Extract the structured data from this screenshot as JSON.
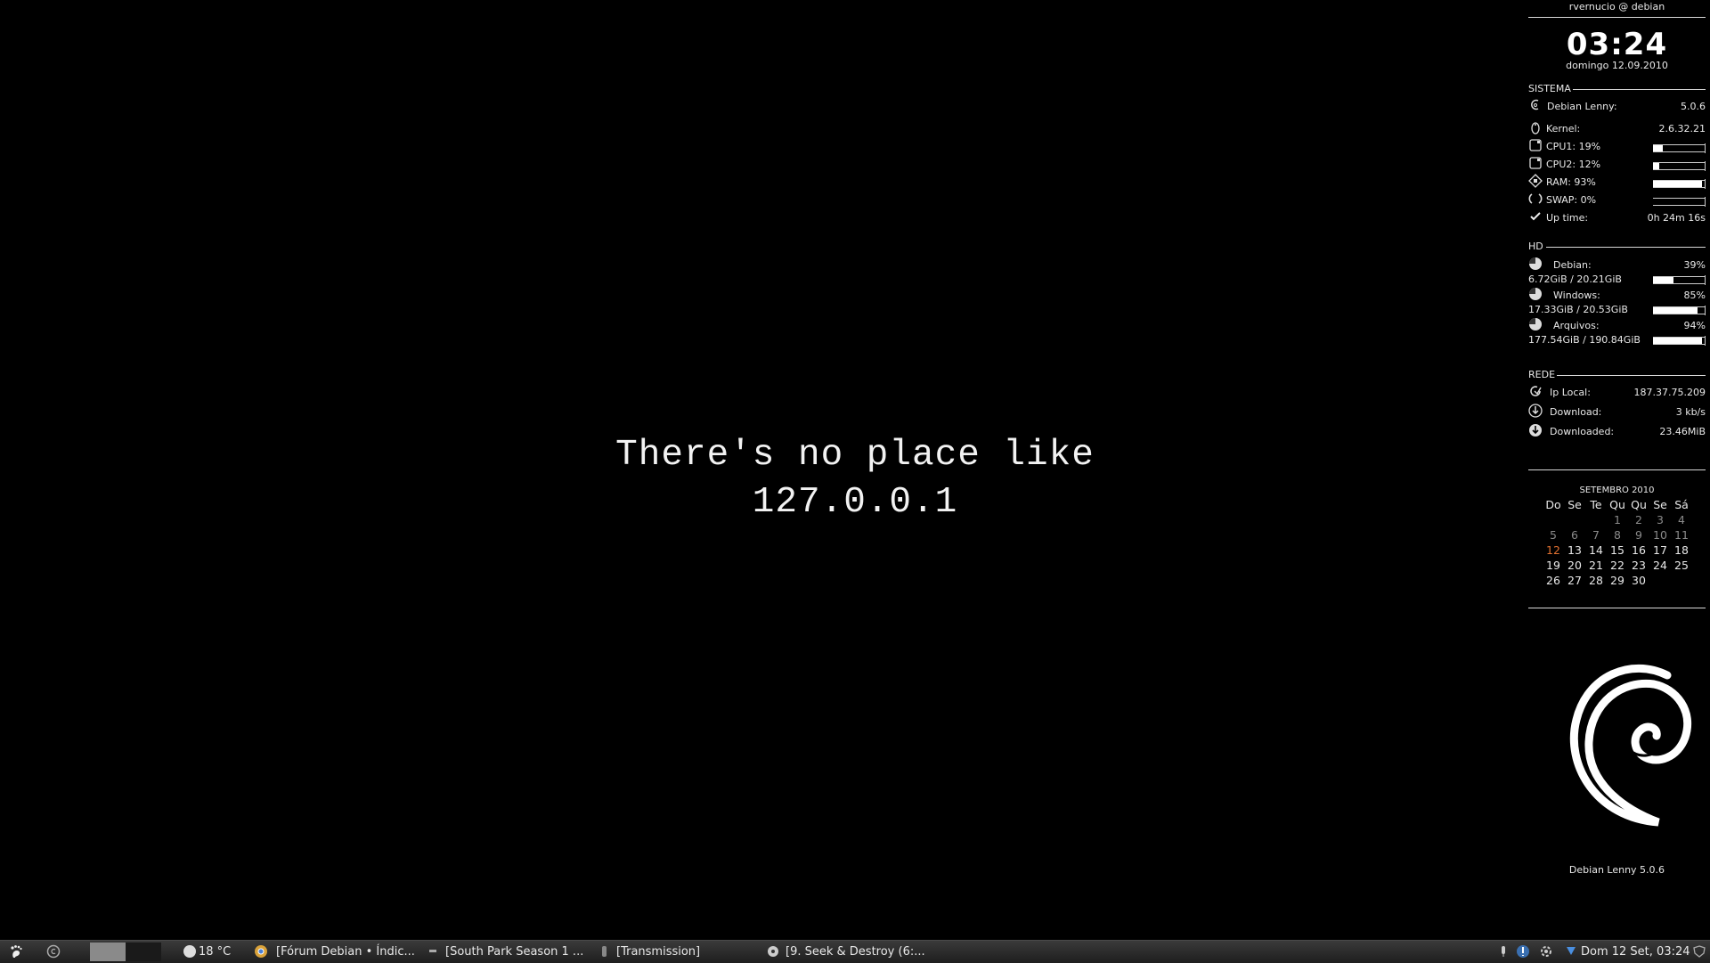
{
  "desktop": {
    "slogan_line1": "There's no place like",
    "slogan_line2": "127.0.0.1"
  },
  "conky": {
    "user_host": "rvernucio @ debian",
    "clock": "03:24",
    "date": "domingo 12.09.2010",
    "sistema": {
      "heading": "SISTEMA",
      "rows": [
        {
          "label": "Debian Lenny:",
          "value": "5.0.6",
          "icon": "debian-icon"
        },
        {
          "label": "Kernel:",
          "value": "2.6.32.21",
          "icon": "tux-icon"
        },
        {
          "label": "CPU1: 19%",
          "percent": 19,
          "icon": "cpu-icon"
        },
        {
          "label": "CPU2: 12%",
          "percent": 12,
          "icon": "cpu-icon"
        },
        {
          "label": "RAM: 93%",
          "percent": 93,
          "icon": "ram-icon"
        },
        {
          "label": "SWAP: 0%",
          "percent": 0,
          "icon": "swap-icon"
        },
        {
          "label": "Up time:",
          "value": "0h 24m 16s",
          "icon": "check-icon"
        }
      ]
    },
    "hd": {
      "heading": "HD",
      "disks": [
        {
          "label": "Debian:",
          "percent_label": "39%",
          "usage": "6.72GiB / 20.21GiB",
          "percent": 39
        },
        {
          "label": "Windows:",
          "percent_label": "85%",
          "usage": "17.33GiB / 20.53GiB",
          "percent": 85
        },
        {
          "label": "Arquivos:",
          "percent_label": "94%",
          "usage": "177.54GiB / 190.84GiB",
          "percent": 94
        }
      ]
    },
    "rede": {
      "heading": "REDE",
      "rows": [
        {
          "label": "Ip Local:",
          "value": "187.37.75.209",
          "icon": "refresh-icon"
        },
        {
          "label": "Download:",
          "value": "3 kb/s",
          "icon": "download-icon"
        },
        {
          "label": "Downloaded:",
          "value": "23.46MiB",
          "icon": "downloaded-icon"
        }
      ]
    },
    "calendar": {
      "title": "SETEMBRO 2010",
      "weekdays": [
        "Do",
        "Se",
        "Te",
        "Qu",
        "Qu",
        "Se",
        "Sá"
      ],
      "weeks": [
        [
          {
            "d": ""
          },
          {
            "d": ""
          },
          {
            "d": ""
          },
          {
            "d": "1",
            "dim": true
          },
          {
            "d": "2",
            "dim": true
          },
          {
            "d": "3",
            "dim": true
          },
          {
            "d": "4",
            "dim": true
          }
        ],
        [
          {
            "d": "5",
            "dim": true
          },
          {
            "d": "6",
            "dim": true
          },
          {
            "d": "7",
            "dim": true
          },
          {
            "d": "8",
            "dim": true
          },
          {
            "d": "9",
            "dim": true
          },
          {
            "d": "10",
            "dim": true
          },
          {
            "d": "11",
            "dim": true
          }
        ],
        [
          {
            "d": "12",
            "today": true
          },
          {
            "d": "13"
          },
          {
            "d": "14"
          },
          {
            "d": "15"
          },
          {
            "d": "16"
          },
          {
            "d": "17"
          },
          {
            "d": "18"
          }
        ],
        [
          {
            "d": "19"
          },
          {
            "d": "20"
          },
          {
            "d": "21"
          },
          {
            "d": "22"
          },
          {
            "d": "23"
          },
          {
            "d": "24"
          },
          {
            "d": "25"
          }
        ],
        [
          {
            "d": "26"
          },
          {
            "d": "27"
          },
          {
            "d": "28"
          },
          {
            "d": "29"
          },
          {
            "d": "30"
          },
          {
            "d": ""
          },
          {
            "d": ""
          }
        ]
      ]
    },
    "logo_caption": "Debian Lenny 5.0.6"
  },
  "taskbar": {
    "weather": "18 °C",
    "windows": [
      {
        "title": "[Fórum Debian • Índic...",
        "icon": "chrome-icon"
      },
      {
        "title": "[South Park Season 1 ...",
        "icon": "folder-icon"
      },
      {
        "title": "[Transmission]",
        "icon": "transmission-icon"
      },
      {
        "title": "[9. Seek & Destroy (6:...",
        "icon": "music-player-icon"
      }
    ],
    "clock": "Dom 12 Set, 03:24"
  },
  "colors": {
    "background": "#000000",
    "text": "#e6e6e6",
    "today": "#e07030"
  }
}
